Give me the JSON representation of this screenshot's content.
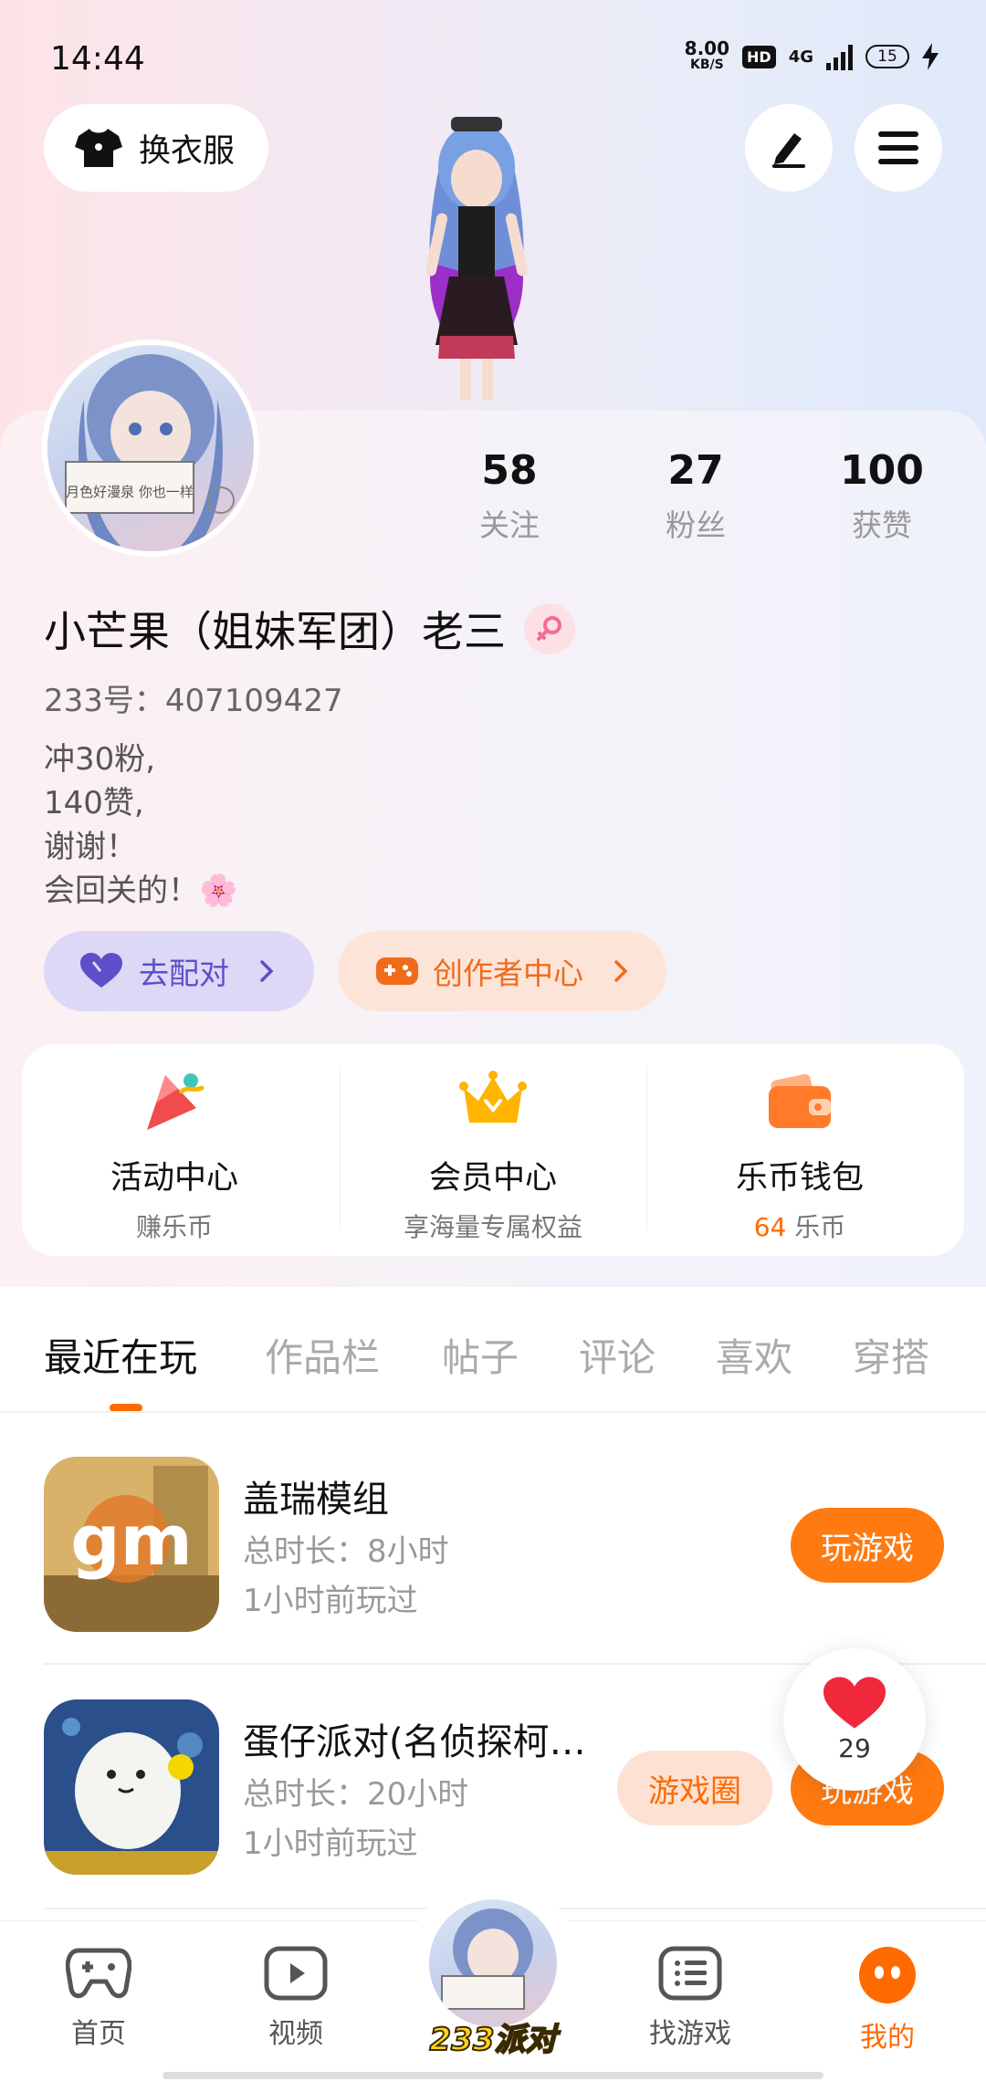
{
  "status_bar": {
    "time": "14:44",
    "speed_value": "8.00",
    "speed_unit": "KB/S",
    "hd": "HD",
    "network": "4G",
    "battery": "15"
  },
  "top": {
    "outfit_label": "换衣服",
    "edit_icon": "edit-icon",
    "menu_icon": "menu-icon"
  },
  "profile": {
    "stats": [
      {
        "num": "58",
        "label": "关注"
      },
      {
        "num": "27",
        "label": "粉丝"
      },
      {
        "num": "100",
        "label": "获赞"
      }
    ],
    "name": "小芒果（姐妹军团）老三",
    "uid": "233号：407109427",
    "bio": [
      "冲30粉,",
      "140赞,",
      "谢谢！",
      "会回关的！🌸"
    ],
    "match_label": "去配对",
    "creator_label": "创作者中心",
    "avatar_text": "月色好漫泉 你也一样"
  },
  "quick_entries": [
    {
      "title": "活动中心",
      "sub": "赚乐币"
    },
    {
      "title": "会员中心",
      "sub": "享海量专属权益"
    },
    {
      "title": "乐币钱包",
      "sub_num": "64",
      "sub": " 乐币"
    }
  ],
  "tabs": [
    "最近在玩",
    "作品栏",
    "帖子",
    "评论",
    "喜欢",
    "穿搭"
  ],
  "games": [
    {
      "title": "盖瑞模组",
      "duration": "总时长：8小时",
      "last": "1小时前玩过",
      "play": "玩游戏",
      "icon_text": "gm"
    },
    {
      "title": "蛋仔派对(名侦探柯…",
      "duration": "总时长：20小时",
      "last": "1小时前玩过",
      "play": "玩游戏",
      "circle": "游戏圈"
    }
  ],
  "float_like": {
    "count": "29"
  },
  "bottom_nav": [
    {
      "label": "首页"
    },
    {
      "label": "视频"
    },
    {
      "label": "233派对"
    },
    {
      "label": "找游戏"
    },
    {
      "label": "我的"
    }
  ],
  "colors": {
    "accent": "#ff6a00",
    "match": "#5d4fc8"
  }
}
